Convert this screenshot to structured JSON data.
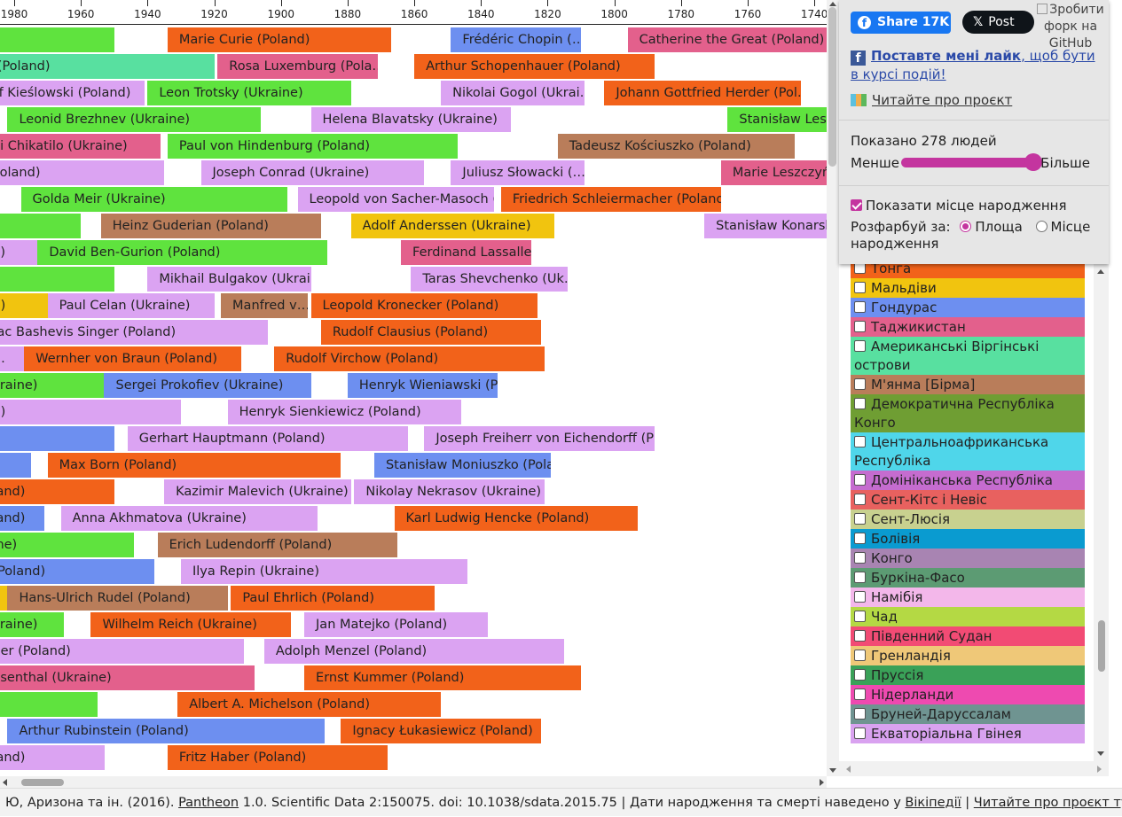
{
  "axis": {
    "ticks": [
      {
        "year": 1980,
        "label": "1980"
      },
      {
        "year": 1960,
        "label": "1960"
      },
      {
        "year": 1940,
        "label": "1940"
      },
      {
        "year": 1920,
        "label": "1920"
      },
      {
        "year": 1900,
        "label": "1900"
      },
      {
        "year": 1880,
        "label": "1880"
      },
      {
        "year": 1860,
        "label": "1860"
      },
      {
        "year": 1840,
        "label": "1840"
      },
      {
        "year": 1820,
        "label": "1820"
      },
      {
        "year": 1800,
        "label": "1800"
      },
      {
        "year": 1780,
        "label": "1780"
      },
      {
        "year": 1760,
        "label": "1760"
      },
      {
        "year": 1740,
        "label": "1740"
      }
    ]
  },
  "people": [
    {
      "row": 0,
      "label": "",
      "start": 1950,
      "end": 1990,
      "color": "#5fe33e"
    },
    {
      "row": 0,
      "label": "Marie Curie (Poland)",
      "start": 1867,
      "end": 1934,
      "color": "#f2621a"
    },
    {
      "row": 0,
      "label": "Frédéric Chopin (…",
      "start": 1810,
      "end": 1849,
      "color": "#6d8ff0"
    },
    {
      "row": 0,
      "label": "Catherine the Great (Poland)",
      "start": 1729,
      "end": 1796,
      "color": "#e3608c"
    },
    {
      "row": 1,
      "label": "n Paul II (Poland)",
      "start": 1920,
      "end": 2005,
      "color": "#58e0a0"
    },
    {
      "row": 1,
      "label": "Rosa Luxemburg (Pola…",
      "start": 1871,
      "end": 1919,
      "color": "#e3608c"
    },
    {
      "row": 1,
      "label": "Arthur Schopenhauer (Poland)",
      "start": 1788,
      "end": 1860,
      "color": "#f2621a"
    },
    {
      "row": 2,
      "label": "sztof Kieślowski (Poland)",
      "start": 1941,
      "end": 1996,
      "color": "#dba3f2"
    },
    {
      "row": 2,
      "label": "Leon Trotsky (Ukraine)",
      "start": 1879,
      "end": 1940,
      "color": "#5fe33e"
    },
    {
      "row": 2,
      "label": "Nikolai Gogol (Ukrai…",
      "start": 1809,
      "end": 1852,
      "color": "#dba3f2"
    },
    {
      "row": 2,
      "label": "Johann Gottfried Herder (Pol…",
      "start": 1744,
      "end": 1803,
      "color": "#f2621a"
    },
    {
      "row": 3,
      "label": "Leonid Brezhnev (Ukraine)",
      "start": 1906,
      "end": 1982,
      "color": "#5fe33e"
    },
    {
      "row": 3,
      "label": "Helena Blavatsky (Ukraine)",
      "start": 1831,
      "end": 1891,
      "color": "#dba3f2"
    },
    {
      "row": 3,
      "label": "Stanisław Leszczyński",
      "start": 1677,
      "end": 1766,
      "color": "#5fe33e"
    },
    {
      "row": 4,
      "label": "drei Chikatilo (Ukraine)",
      "start": 1936,
      "end": 1994,
      "color": "#e3608c"
    },
    {
      "row": 4,
      "label": "Paul von Hindenburg (Poland)",
      "start": 1847,
      "end": 1934,
      "color": "#5fe33e"
    },
    {
      "row": 4,
      "label": "Tadeusz Kościuszko (Poland)",
      "start": 1746,
      "end": 1817,
      "color": "#b97d5a"
    },
    {
      "row": 5,
      "label": "Poland)",
      "start": 1935,
      "end": 1990,
      "color": "#dba3f2"
    },
    {
      "row": 5,
      "label": "Joseph Conrad (Ukraine)",
      "start": 1857,
      "end": 1924,
      "color": "#dba3f2"
    },
    {
      "row": 5,
      "label": "Juliusz Słowacki (…",
      "start": 1809,
      "end": 1849,
      "color": "#dba3f2"
    },
    {
      "row": 5,
      "label": "Marie Leszczyńska",
      "start": 1703,
      "end": 1768,
      "color": "#e3608c"
    },
    {
      "row": 6,
      "label": "Golda Meir (Ukraine)",
      "start": 1898,
      "end": 1978,
      "color": "#5fe33e"
    },
    {
      "row": 6,
      "label": "Leopold von Sacher-Masoch (…",
      "start": 1836,
      "end": 1895,
      "color": "#dba3f2"
    },
    {
      "row": 6,
      "label": "Friedrich Schleiermacher (Poland)",
      "start": 1768,
      "end": 1834,
      "color": "#f2621a"
    },
    {
      "row": 7,
      "label": "",
      "start": 1960,
      "end": 1990,
      "color": "#5fe33e"
    },
    {
      "row": 7,
      "label": "Heinz Guderian (Poland)",
      "start": 1888,
      "end": 1954,
      "color": "#b97d5a"
    },
    {
      "row": 7,
      "label": "Adolf Anderssen (Ukraine)",
      "start": 1818,
      "end": 1879,
      "color": "#f1c40f"
    },
    {
      "row": 7,
      "label": "Stanisław Konarski",
      "start": 1700,
      "end": 1773,
      "color": "#dba3f2"
    },
    {
      "row": 8,
      "label": "e)",
      "start": 1960,
      "end": 1990,
      "color": "#dba3f2"
    },
    {
      "row": 8,
      "label": "David Ben-Gurion (Poland)",
      "start": 1886,
      "end": 1973,
      "color": "#5fe33e"
    },
    {
      "row": 8,
      "label": "Ferdinand Lassalle…",
      "start": 1825,
      "end": 1864,
      "color": "#e3608c"
    },
    {
      "row": 9,
      "label": "",
      "start": 1950,
      "end": 1990,
      "color": "#5fe33e"
    },
    {
      "row": 9,
      "label": "Mikhail Bulgakov (Ukrai…",
      "start": 1891,
      "end": 1940,
      "color": "#dba3f2"
    },
    {
      "row": 9,
      "label": "Taras Shevchenko (Uk…",
      "start": 1814,
      "end": 1861,
      "color": "#dba3f2"
    },
    {
      "row": 10,
      "label": "d)",
      "start": 1970,
      "end": 1990,
      "color": "#f1c40f"
    },
    {
      "row": 10,
      "label": "Paul Celan (Ukraine)",
      "start": 1920,
      "end": 1970,
      "color": "#dba3f2"
    },
    {
      "row": 10,
      "label": "Manfred v…",
      "start": 1892,
      "end": 1918,
      "color": "#b97d5a"
    },
    {
      "row": 10,
      "label": "Leopold Kronecker (Poland)",
      "start": 1823,
      "end": 1891,
      "color": "#f2621a"
    },
    {
      "row": 11,
      "label": "aac Bashevis Singer (Poland)",
      "start": 1904,
      "end": 1991,
      "color": "#dba3f2"
    },
    {
      "row": 11,
      "label": "Rudolf Clausius (Poland)",
      "start": 1822,
      "end": 1888,
      "color": "#f2621a"
    },
    {
      "row": 12,
      "label": "…",
      "start": 1975,
      "end": 1990,
      "color": "#dba3f2"
    },
    {
      "row": 12,
      "label": "Wernher von Braun (Poland)",
      "start": 1912,
      "end": 1977,
      "color": "#f2621a"
    },
    {
      "row": 12,
      "label": "Rudolf Virchow (Poland)",
      "start": 1821,
      "end": 1902,
      "color": "#f2621a"
    },
    {
      "row": 13,
      "label": "kraine)",
      "start": 1950,
      "end": 1990,
      "color": "#5fe33e"
    },
    {
      "row": 13,
      "label": "Sergei Prokofiev (Ukraine)",
      "start": 1891,
      "end": 1953,
      "color": "#6d8ff0"
    },
    {
      "row": 13,
      "label": "Henryk Wieniawski (P…",
      "start": 1835,
      "end": 1880,
      "color": "#6d8ff0"
    },
    {
      "row": 14,
      "label": "d)",
      "start": 1930,
      "end": 1990,
      "color": "#dba3f2"
    },
    {
      "row": 14,
      "label": "Henryk Sienkiewicz (Poland)",
      "start": 1846,
      "end": 1916,
      "color": "#dba3f2"
    },
    {
      "row": 15,
      "label": ")",
      "start": 1950,
      "end": 1990,
      "color": "#6d8ff0"
    },
    {
      "row": 15,
      "label": "Gerhart Hauptmann (Poland)",
      "start": 1862,
      "end": 1946,
      "color": "#dba3f2"
    },
    {
      "row": 15,
      "label": "Joseph Freiherr von Eichendorff (P…",
      "start": 1788,
      "end": 1857,
      "color": "#dba3f2"
    },
    {
      "row": 16,
      "label": "",
      "start": 1975,
      "end": 1990,
      "color": "#6d8ff0"
    },
    {
      "row": 16,
      "label": "Max Born (Poland)",
      "start": 1882,
      "end": 1970,
      "color": "#f2621a"
    },
    {
      "row": 16,
      "label": "Stanisław Moniuszko (Pola…",
      "start": 1819,
      "end": 1872,
      "color": "#6d8ff0"
    },
    {
      "row": 17,
      "label": "land)",
      "start": 1950,
      "end": 1990,
      "color": "#f2621a"
    },
    {
      "row": 17,
      "label": "Kazimir Malevich (Ukraine)",
      "start": 1879,
      "end": 1935,
      "color": "#dba3f2"
    },
    {
      "row": 17,
      "label": "Nikolay Nekrasov (Ukraine)",
      "start": 1821,
      "end": 1878,
      "color": "#dba3f2"
    },
    {
      "row": 18,
      "label": "land)",
      "start": 1971,
      "end": 1990,
      "color": "#6d8ff0"
    },
    {
      "row": 18,
      "label": "Anna Akhmatova (Ukraine)",
      "start": 1889,
      "end": 1966,
      "color": "#dba3f2"
    },
    {
      "row": 18,
      "label": "Karl Ludwig Hencke (Poland)",
      "start": 1793,
      "end": 1866,
      "color": "#f2621a"
    },
    {
      "row": 19,
      "label": "ine)",
      "start": 1944,
      "end": 1990,
      "color": "#5fe33e"
    },
    {
      "row": 19,
      "label": "Erich Ludendorff (Poland)",
      "start": 1865,
      "end": 1937,
      "color": "#b97d5a"
    },
    {
      "row": 20,
      "label": "(Poland)",
      "start": 1938,
      "end": 1990,
      "color": "#6d8ff0"
    },
    {
      "row": 20,
      "label": "Ilya Repin (Ukraine)",
      "start": 1844,
      "end": 1930,
      "color": "#dba3f2"
    },
    {
      "row": 21,
      "label": "",
      "start": 1975,
      "end": 1990,
      "color": "#f1c40f"
    },
    {
      "row": 21,
      "label": "Hans-Ulrich Rudel (Poland)",
      "start": 1916,
      "end": 1982,
      "color": "#b97d5a"
    },
    {
      "row": 21,
      "label": "Paul Ehrlich (Poland)",
      "start": 1854,
      "end": 1915,
      "color": "#f2621a"
    },
    {
      "row": 22,
      "label": "kraine)",
      "start": 1965,
      "end": 1990,
      "color": "#5fe33e"
    },
    {
      "row": 22,
      "label": "Wilhelm Reich (Ukraine)",
      "start": 1897,
      "end": 1957,
      "color": "#f2621a"
    },
    {
      "row": 22,
      "label": "Jan Matejko (Poland)",
      "start": 1838,
      "end": 1893,
      "color": "#dba3f2"
    },
    {
      "row": 23,
      "label": "der (Poland)",
      "start": 1911,
      "end": 1990,
      "color": "#dba3f2"
    },
    {
      "row": 23,
      "label": "Adolph Menzel (Poland)",
      "start": 1815,
      "end": 1905,
      "color": "#dba3f2"
    },
    {
      "row": 24,
      "label": "esenthal (Ukraine)",
      "start": 1908,
      "end": 1990,
      "color": "#e3608c"
    },
    {
      "row": 24,
      "label": "Ernst Kummer (Poland)",
      "start": 1810,
      "end": 1893,
      "color": "#f2621a"
    },
    {
      "row": 25,
      "label": "",
      "start": 1955,
      "end": 1990,
      "color": "#5fe33e"
    },
    {
      "row": 25,
      "label": "Albert A. Michelson (Poland)",
      "start": 1852,
      "end": 1931,
      "color": "#f2621a"
    },
    {
      "row": 26,
      "label": "Arthur Rubinstein (Poland)",
      "start": 1887,
      "end": 1982,
      "color": "#6d8ff0"
    },
    {
      "row": 26,
      "label": "Ignacy Łukasiewicz (Poland)",
      "start": 1822,
      "end": 1882,
      "color": "#f2621a"
    },
    {
      "row": 27,
      "label": "land)",
      "start": 1953,
      "end": 1990,
      "color": "#dba3f2"
    },
    {
      "row": 27,
      "label": "Fritz Haber (Poland)",
      "start": 1868,
      "end": 1934,
      "color": "#f2621a"
    }
  ],
  "share": {
    "facebook_label": "Share",
    "facebook_count": "17K",
    "x_label": "Post",
    "github_alt": "Зробити форк на GitHub"
  },
  "like": {
    "link_text": "Поставте мені лайк",
    "rest_text": ", щоб бути в курсі подій!"
  },
  "about_link": "Читайте про проєкт",
  "shown_count": "Показано 278 людей",
  "slider": {
    "less": "Менше",
    "more": "Більше",
    "level": 1.0
  },
  "show_birthplace": {
    "label": "Показати місце народження",
    "checked": true
  },
  "color_by": {
    "label": "Розфарбуй за:",
    "options": [
      {
        "label": "Площа",
        "selected": true
      },
      {
        "label": "Місце народження",
        "selected": false
      }
    ]
  },
  "legend": [
    {
      "label": "Тонга",
      "color": "#f2621a"
    },
    {
      "label": "Мальдіви",
      "color": "#f1c40f"
    },
    {
      "label": "Гондурас",
      "color": "#6d8ff0"
    },
    {
      "label": "Таджикистан",
      "color": "#e3608c"
    },
    {
      "label": "Американські Віргінські острови",
      "color": "#58e0a0"
    },
    {
      "label": "М'янма [Бірма]",
      "color": "#b97d5a"
    },
    {
      "label": "Демократична Республіка Конго",
      "color": "#6f9e33"
    },
    {
      "label": "Центральноафриканська Республіка",
      "color": "#4fd6ea"
    },
    {
      "label": "Домініканська Республіка",
      "color": "#c56ccf"
    },
    {
      "label": "Сент-Кітс і Невіс",
      "color": "#e8615f"
    },
    {
      "label": "Сент-Люсія",
      "color": "#c8d18f"
    },
    {
      "label": "Болівія",
      "color": "#0a9bd0"
    },
    {
      "label": "Конго",
      "color": "#a884b2"
    },
    {
      "label": "Буркіна-Фасо",
      "color": "#5c9b73"
    },
    {
      "label": "Намібія",
      "color": "#f3b7ea"
    },
    {
      "label": "Чад",
      "color": "#b4d944"
    },
    {
      "label": "Південний Судан",
      "color": "#f24b74"
    },
    {
      "label": "Гренландія",
      "color": "#efc878"
    },
    {
      "label": "Пруссія",
      "color": "#3aa158"
    },
    {
      "label": "Нідерланди",
      "color": "#ee4ab0"
    },
    {
      "label": "Бруней-Даруссалам",
      "color": "#6f9491"
    },
    {
      "label": "Екваторіальна Гвінея",
      "color": "#d9a2f0"
    }
  ],
  "footer": {
    "citation_start": "Ю, Аризона та ін. (2016).",
    "pantheon": "Pantheon",
    "citation_rest": "1.0. Scientific Data 2:150075. doi: 10.1038/sdata.2015.75 | Дати народження та смерті наведено у",
    "wikipedia": "Вікіпедії",
    "separator": "|",
    "about": "Читайте про проєкт тут →"
  }
}
